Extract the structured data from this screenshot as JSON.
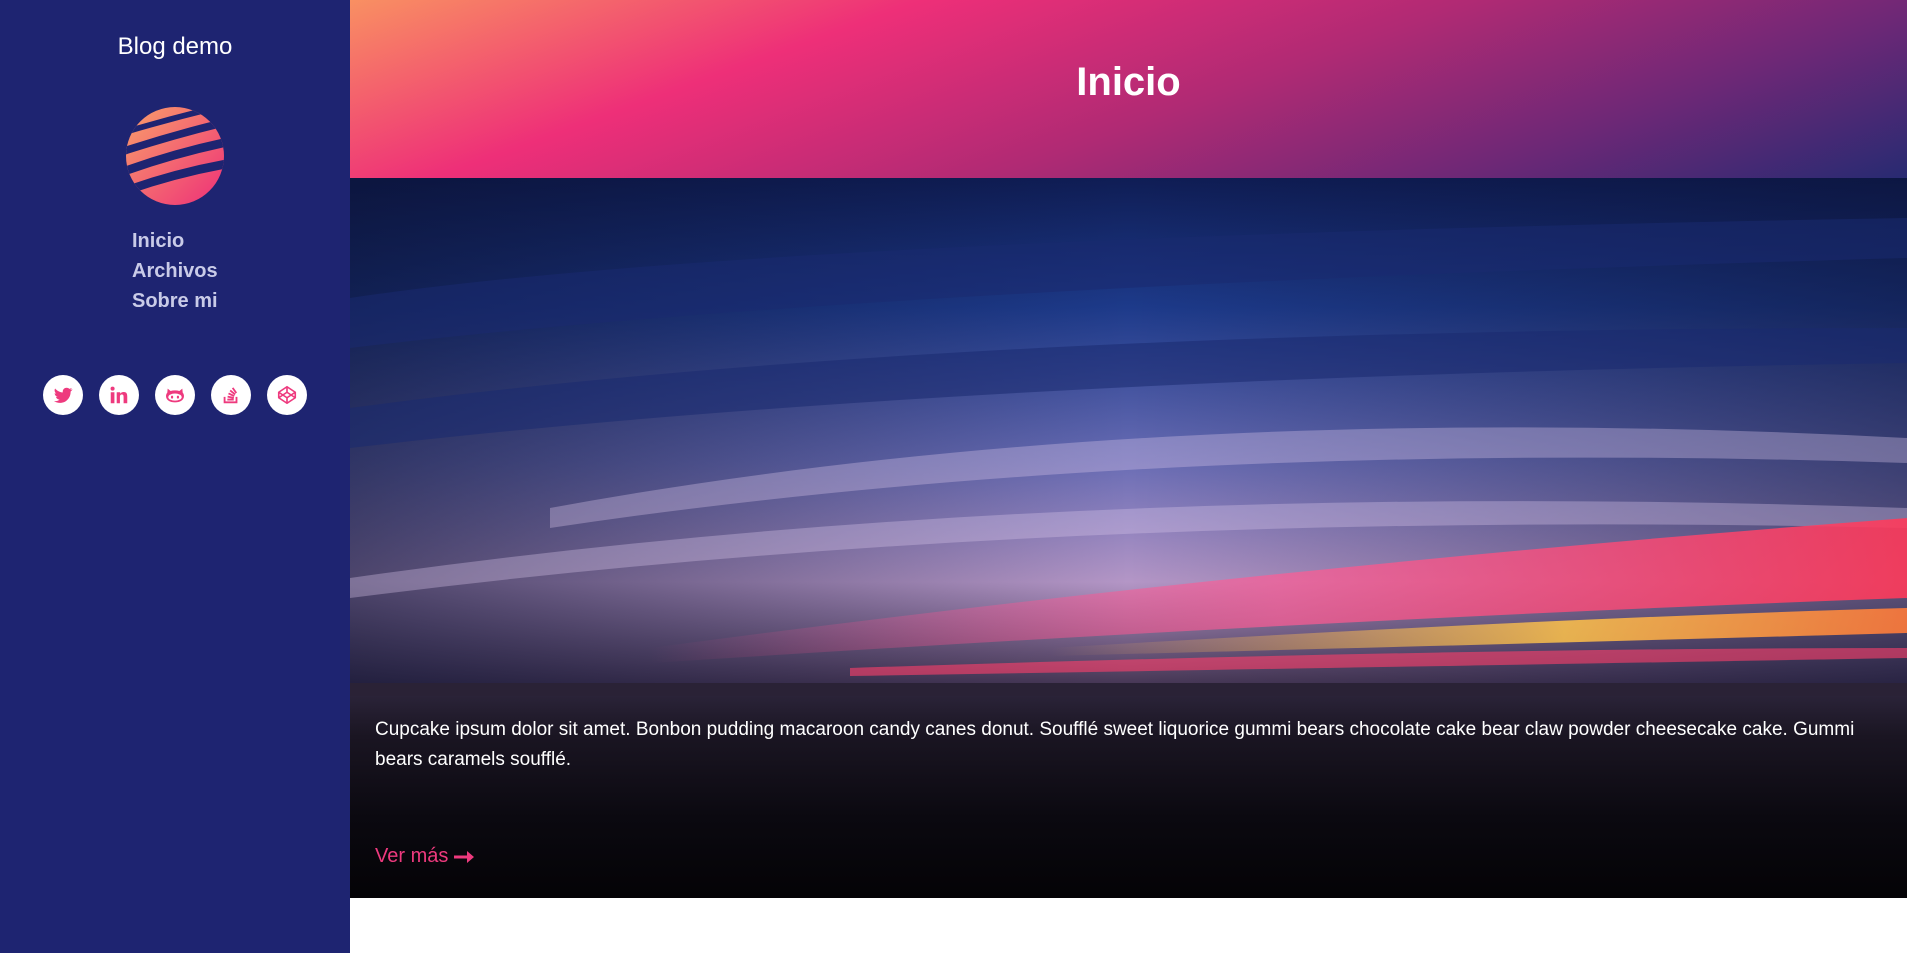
{
  "sidebar": {
    "site_title": "Blog demo",
    "nav": [
      {
        "label": "Inicio"
      },
      {
        "label": "Archivos"
      },
      {
        "label": "Sobre mi"
      }
    ],
    "social": [
      {
        "icon": "twitter-icon"
      },
      {
        "icon": "linkedin-icon"
      },
      {
        "icon": "github-icon"
      },
      {
        "icon": "stackoverflow-icon"
      },
      {
        "icon": "codepen-icon"
      }
    ]
  },
  "header": {
    "title": "Inicio"
  },
  "post": {
    "excerpt": "Cupcake ipsum dolor sit amet. Bonbon pudding macaroon candy canes donut. Soufflé sweet liquorice gummi bears chocolate cake bear claw powder cheesecake cake. Gummi bears caramels soufflé.",
    "read_more": "Ver más"
  },
  "colors": {
    "sidebar_bg": "#1e2471",
    "accent_pink": "#ee3a7e",
    "nav_text": "#c9cbe8",
    "header_gradient": [
      "#f99062",
      "#ee2f78",
      "#6d2876",
      "#282a72"
    ]
  }
}
